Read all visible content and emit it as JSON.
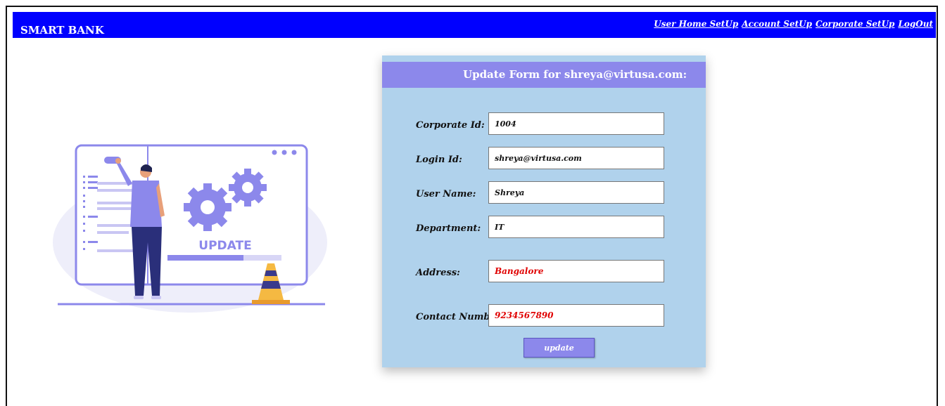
{
  "header": {
    "brand": "SMART BANK",
    "nav": [
      {
        "label": "User Home SetUp"
      },
      {
        "label": "Account SetUp"
      },
      {
        "label": "Corporate SetUp"
      },
      {
        "label": "LogOut"
      }
    ]
  },
  "illustration": {
    "caption": "UPDATE"
  },
  "form": {
    "title": "Update Form for shreya@virtusa.com:",
    "fields": [
      {
        "label": "Corporate Id:",
        "value": "1004"
      },
      {
        "label": "Login Id:",
        "value": "shreya@virtusa.com"
      },
      {
        "label": "User Name:",
        "value": "Shreya"
      },
      {
        "label": "Department:",
        "value": "IT"
      },
      {
        "label": "Address:",
        "value": "Bangalore"
      },
      {
        "label": "Contact Number:",
        "value": "9234567890"
      }
    ],
    "submit_label": "update"
  },
  "colors": {
    "topbar": "#0000ff",
    "card": "#b0d2ec",
    "accent": "#8c88eb",
    "error_text": "#e00000"
  }
}
